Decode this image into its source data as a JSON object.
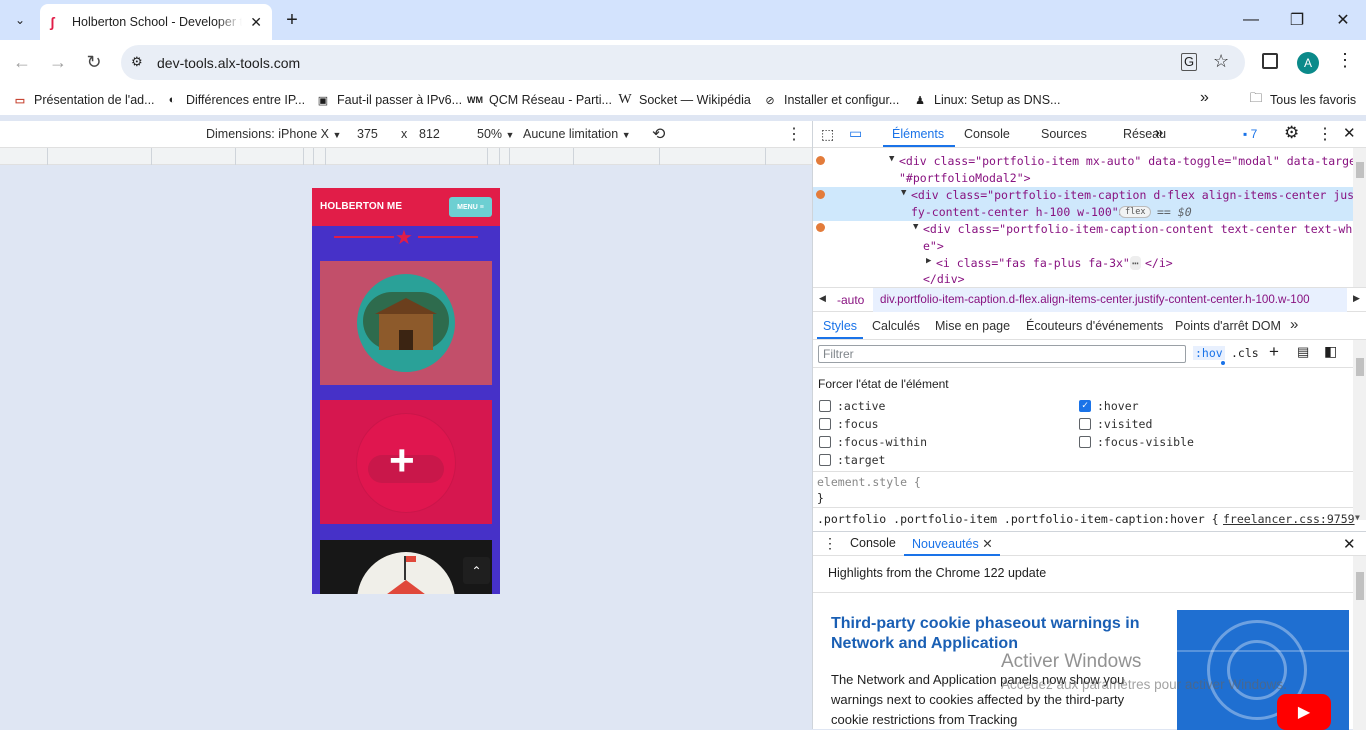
{
  "browser": {
    "tab": {
      "title": "Holberton School - Developer t",
      "favicon": "holberton-icon"
    },
    "new_tab_symbol": "+",
    "window_controls": {
      "minimize": "—",
      "restore": "❐",
      "close": "✕"
    },
    "url": "dev-tools.alx-tools.com",
    "bookmarks": [
      {
        "label": "Présentation de l'ad...",
        "icon": "oracle-icon",
        "color": "#c74634"
      },
      {
        "label": "Différences entre IP...",
        "icon": "site-icon",
        "color": "#555"
      },
      {
        "label": "Faut-il passer à IPv6...",
        "icon": "laptop-icon",
        "color": "#333"
      },
      {
        "label": "QCM Réseau - Parti...",
        "icon": "wm-icon",
        "color": "#222"
      },
      {
        "label": "Socket — Wikipédia",
        "icon": "wikipedia-icon",
        "color": "#000"
      },
      {
        "label": "Installer et configur...",
        "icon": "link-icon",
        "color": "#444"
      },
      {
        "label": "Linux: Setup as DNS...",
        "icon": "linux-icon",
        "color": "#222"
      }
    ],
    "bookmarks_overflow": "»",
    "all_bookmarks": "Tous les favoris",
    "profile_initial": "A"
  },
  "device_toolbar": {
    "dimensions_label": "Dimensions: iPhone X",
    "width": "375",
    "times": "x",
    "height": "812",
    "zoom": "50%",
    "throttle": "Aucune limitation"
  },
  "mobile_page": {
    "brand": "HOLBERTON ME",
    "menu": "MENU ≡",
    "colors": {
      "nav": "#e11d48",
      "page": "#4631c8",
      "card1": "#c24f6a",
      "card2": "#d6174f",
      "card3": "#171717"
    },
    "scroll_top": "⌃"
  },
  "devtools": {
    "tabs": [
      "Éléments",
      "Console",
      "Sources",
      "Réseau"
    ],
    "issues_count": "7",
    "elements": {
      "line0": "<div class=\"portfolio-item mx-auto\" data-toggle=\"modal\" data-target=",
      "line0b": "\"#portfolioModal2\">",
      "line1": "<div class=\"portfolio-item-caption d-flex align-items-center justi",
      "line1b": "fy-content-center h-100 w-100\">",
      "line1_badge": "flex",
      "line1_eq": "== $0",
      "line2": "<div class=\"portfolio-item-caption-content text-center text-whit",
      "line2b": "e\">",
      "line3": "<i class=\"fas fa-plus fa-3x\">",
      "line3_ellipsis": "⋯",
      "line3_end": "</i>",
      "line4": "</div>"
    },
    "breadcrumb": {
      "left": "-auto",
      "current": "div.portfolio-item-caption.d-flex.align-items-center.justify-content-center.h-100.w-100"
    },
    "subtabs": [
      "Styles",
      "Calculés",
      "Mise en page",
      "Écouteurs d'événements",
      "Points d'arrêt DOM"
    ],
    "filter_placeholder": "Filtrer",
    "hov": ":hov",
    "cls": ".cls",
    "force_state_title": "Forcer l'état de l'élément",
    "states_left": [
      ":active",
      ":focus",
      ":focus-within",
      ":target"
    ],
    "states_right": [
      ":hover",
      ":visited",
      ":focus-visible"
    ],
    "element_style": "element.style {",
    "close_brace": "}",
    "rule_selector": ".portfolio .portfolio-item .portfolio-item-caption:hover {",
    "rule_source": "freelancer.css:9759",
    "drawer_tabs": [
      "Console",
      "Nouveautés"
    ],
    "highlights": "Highlights from the Chrome 122 update",
    "article_title": "Third-party cookie phaseout warnings in Network and Application",
    "article_body": "The Network and Application panels now show you warnings next to cookies affected by the third-party cookie restrictions from Tracking",
    "watermark_title": "Activer Windows",
    "watermark_sub": "Accédez aux paramètres pour activer Windows."
  }
}
